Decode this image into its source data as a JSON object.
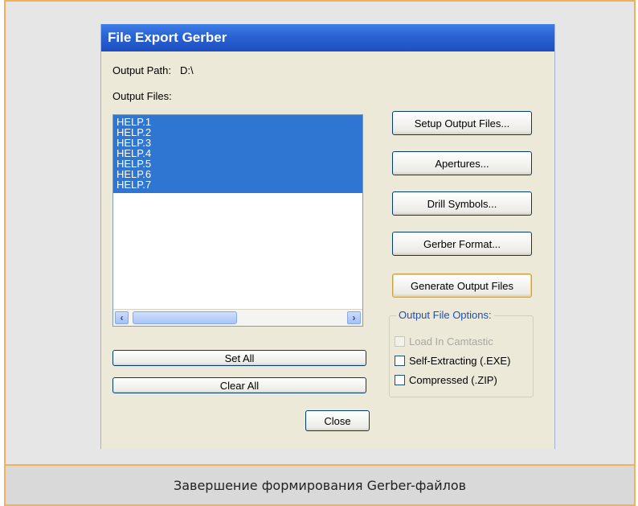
{
  "dialog": {
    "title": "File Export Gerber",
    "output_path_label": "Output Path:",
    "output_path_value": "D:\\",
    "output_files_label": "Output Files:",
    "files": [
      "HELP.1",
      "HELP.2",
      "HELP.3",
      "HELP.4",
      "HELP.5",
      "HELP.6",
      "HELP.7"
    ],
    "buttons": {
      "setup_output_files": "Setup Output Files...",
      "apertures": "Apertures...",
      "drill_symbols": "Drill Symbols...",
      "gerber_format": "Gerber Format...",
      "generate_output_files": "Generate Output Files",
      "set_all": "Set All",
      "clear_all": "Clear All",
      "close": "Close"
    },
    "output_file_options": {
      "title": "Output File Options:",
      "load_in_camtastic": "Load In Camtastic",
      "self_extracting": "Self-Extracting (.EXE)",
      "compressed": "Compressed (.ZIP)"
    }
  },
  "caption": "Завершение формирования Gerber-файлов",
  "colors": {
    "frame_border": "#f0b15a",
    "selection": "#2f76d2",
    "titlebar": "#2a62d3"
  }
}
